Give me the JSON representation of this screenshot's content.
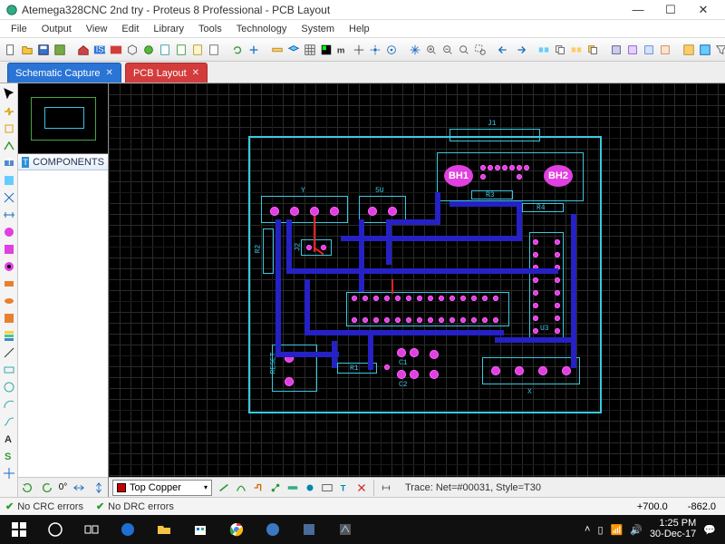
{
  "window": {
    "title": "Atemega328CNC 2nd try - Proteus 8 Professional - PCB Layout"
  },
  "menu": [
    "File",
    "Output",
    "View",
    "Edit",
    "Library",
    "Tools",
    "Technology",
    "System",
    "Help"
  ],
  "tabs": [
    {
      "label": "Schematic Capture",
      "style": "blue"
    },
    {
      "label": "PCB Layout",
      "style": "red"
    }
  ],
  "sidepanel": {
    "components_header": "COMPONENTS"
  },
  "layer_selector": {
    "value": "Top Copper"
  },
  "trace_info": "Trace: Net=#00031, Style=T30",
  "status": {
    "crc": "No CRC errors",
    "drc": "No DRC errors",
    "x": "+700.0",
    "y": "-862.0"
  },
  "board_labels": {
    "bh1": "BH1",
    "bh2": "BH2",
    "j1": "J1",
    "r3": "R3",
    "r4": "R4",
    "r2": "R2",
    "r1": "R1",
    "u3": "U3",
    "c1": "C1",
    "c2": "C2",
    "reset": "RESET",
    "fiveu": "5U",
    "x": "X",
    "y": "Y",
    "j2": "J2"
  },
  "rotation": "0°",
  "clock": {
    "time": "1:25 PM",
    "date": "30-Dec-17"
  }
}
